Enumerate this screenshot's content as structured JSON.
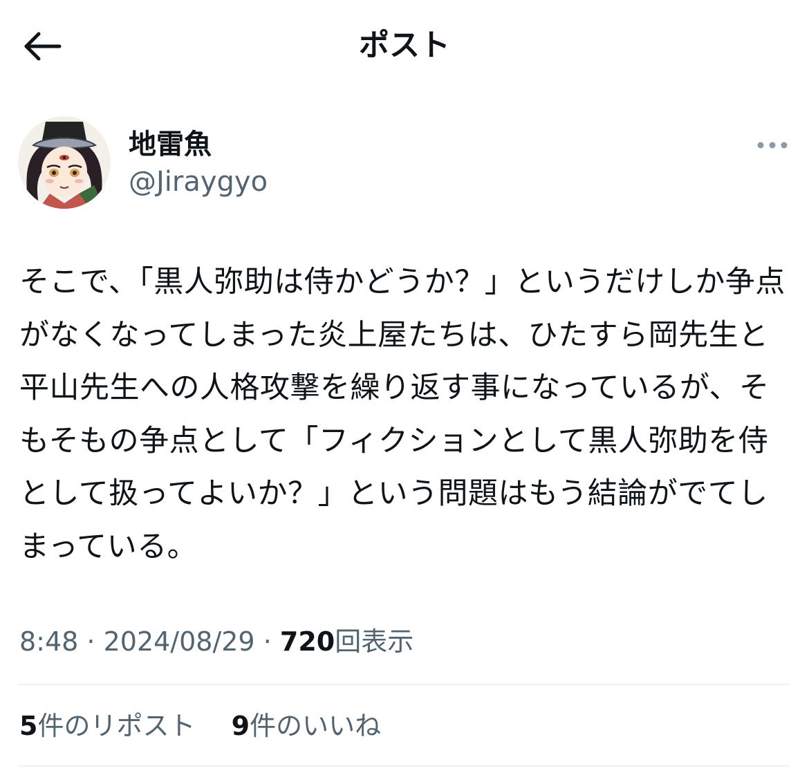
{
  "header": {
    "title": "ポスト",
    "back_icon": "arrow-left-icon"
  },
  "author": {
    "display_name": "地雷魚",
    "handle": "@Jiraygyo",
    "avatar_icon": "avatar-image",
    "more_icon": "more-horizontal-icon"
  },
  "tweet": {
    "text": "そこで、「黒人弥助は侍かどうか？」というだけしか争点がなくなってしまった炎上屋たちは、ひたすら岡先生と平山先生への人格攻撃を繰り返す事になっているが、そもそもの争点として「フィクションとして黒人弥助を侍として扱ってよいか？」という問題はもう結論がでてしまっている。"
  },
  "meta": {
    "time": "8:48",
    "sep1": " · ",
    "date": "2024/08/29",
    "sep2": " · ",
    "views_count": "720",
    "views_label": "回表示"
  },
  "stats": {
    "reposts_count": "5",
    "reposts_label": "件のリポスト",
    "likes_count": "9",
    "likes_label": "件のいいね"
  },
  "colors": {
    "text_primary": "#0f1419",
    "text_secondary": "#536471",
    "divider": "#eff3f4"
  }
}
